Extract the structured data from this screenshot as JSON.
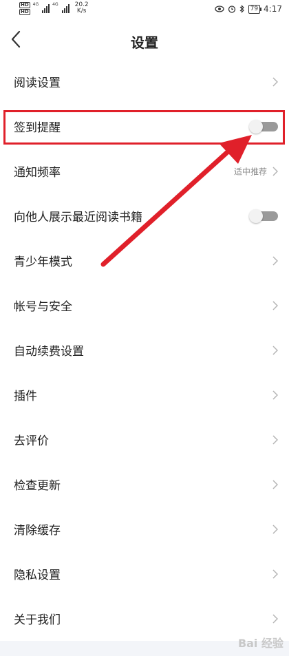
{
  "status_bar": {
    "hd": "HD",
    "net1": "4G",
    "net2": "4G",
    "speed_value": "20.2",
    "speed_unit": "K/s",
    "battery": "79",
    "time": "4:17"
  },
  "header": {
    "title": "设置"
  },
  "items": [
    {
      "label": "阅读设置"
    },
    {
      "label": "签到提醒",
      "toggle_on": false
    },
    {
      "label": "通知频率",
      "value": "适中推荐"
    },
    {
      "label": "向他人展示最近阅读书籍",
      "toggle_on": false
    },
    {
      "label": "青少年模式"
    },
    {
      "label": "帐号与安全"
    },
    {
      "label": "自动续费设置"
    },
    {
      "label": "插件"
    },
    {
      "label": "去评价"
    },
    {
      "label": "检查更新"
    },
    {
      "label": "清除缓存"
    },
    {
      "label": "隐私设置"
    },
    {
      "label": "关于我们"
    }
  ],
  "watermark": "Bai 经验",
  "colors": {
    "highlight": "#e0202a",
    "arrow": "#e0202a",
    "toggle_track": "#9a9a9a"
  }
}
